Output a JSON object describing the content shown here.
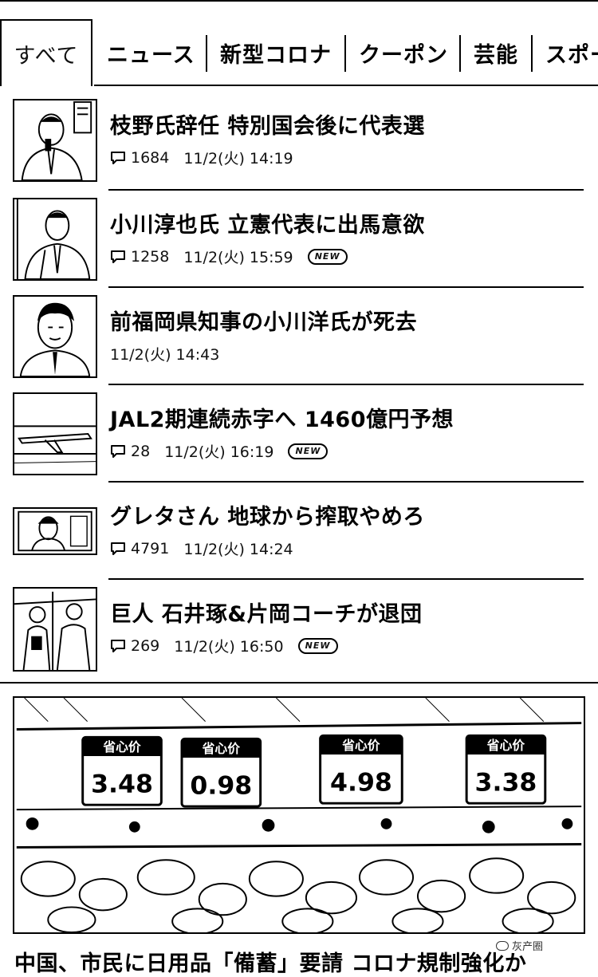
{
  "tabs": [
    {
      "label": "すべて",
      "active": true
    },
    {
      "label": "ニュース"
    },
    {
      "label": "新型コロナ"
    },
    {
      "label": "クーポン"
    },
    {
      "label": "芸能"
    },
    {
      "label": "スポーツ"
    }
  ],
  "news": [
    {
      "headline": "枝野氏辞任 特別国会後に代表選",
      "comments": "1684",
      "time": "11/2(火) 14:19",
      "badge": ""
    },
    {
      "headline": "小川淳也氏 立憲代表に出馬意欲",
      "comments": "1258",
      "time": "11/2(火) 15:59",
      "badge": "NEW"
    },
    {
      "headline": "前福岡県知事の小川洋氏が死去",
      "comments": "",
      "time": "11/2(火) 14:43",
      "badge": ""
    },
    {
      "headline": "JAL2期連続赤字へ 1460億円予想",
      "comments": "28",
      "time": "11/2(火) 16:19",
      "badge": "NEW"
    },
    {
      "headline": "グレタさん 地球から搾取やめろ",
      "comments": "4791",
      "time": "11/2(火) 14:24",
      "badge": ""
    },
    {
      "headline": "巨人 石井琢&片岡コーチが退団",
      "comments": "269",
      "time": "11/2(火) 16:50",
      "badge": "NEW"
    }
  ],
  "feature": {
    "headline": "中国、市民に日用品「備蓄」要請 コロナ規制強化か",
    "price_tags": [
      {
        "label": "省心价",
        "price": "3.48"
      },
      {
        "label": "省心价",
        "price": "0.98"
      },
      {
        "label": "省心价",
        "price": "4.98"
      },
      {
        "label": "省心价",
        "price": "3.38"
      }
    ]
  },
  "watermark": {
    "text": "灰产圈"
  },
  "icons": {
    "comment": "comment-icon",
    "new_badge": "new-badge"
  }
}
